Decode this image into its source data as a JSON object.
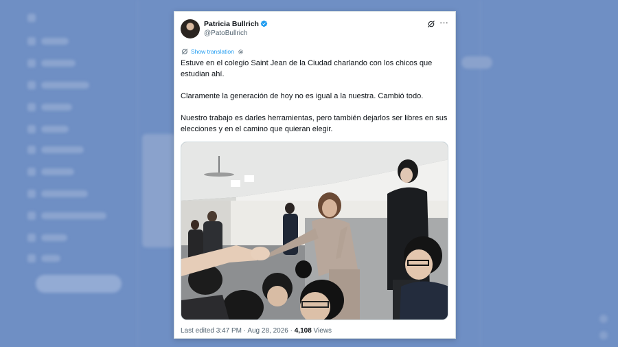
{
  "tweet": {
    "author_name": "Patricia Bullrich",
    "handle": "@PatoBullrich",
    "translation_label": "Show translation",
    "paragraphs": [
      "Estuve en el colegio Saint Jean de la Ciudad charlando con los chicos que estudian ahí.",
      "Claramente la generación de hoy no es igual a la nuestra. Cambió todo.",
      "Nuestro trabajo es darles herramientas, pero también dejarlos ser libres en sus elecciones y en el camino que quieran elegir."
    ],
    "footer": {
      "edited_label": "Last edited",
      "time": "3:47 PM",
      "separator": "·",
      "date": "Aug 28, 2026",
      "views_count": "4,108",
      "views_label": "Views"
    },
    "accent_color": "#1d9bf0",
    "verified_icon": "verified-badge-icon",
    "more_icon": "more-options-icon"
  }
}
